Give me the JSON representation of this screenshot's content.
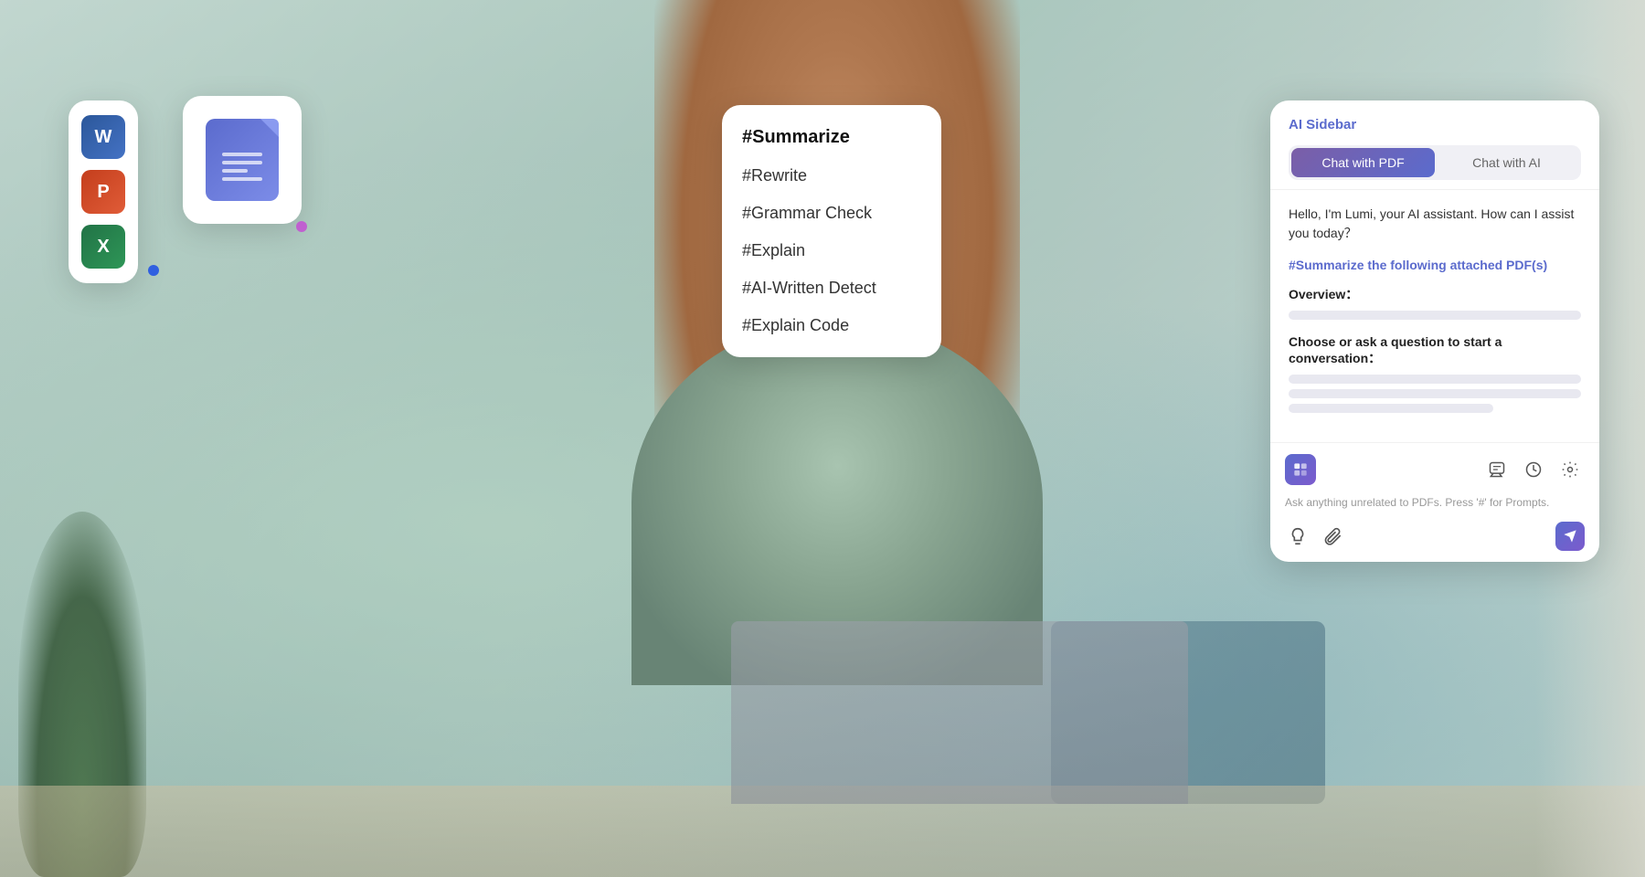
{
  "background": {
    "description": "Woman in green jacket working on laptop"
  },
  "file_icons_panel": {
    "icons": [
      {
        "id": "word",
        "label": "W",
        "type": "word"
      },
      {
        "id": "powerpoint",
        "label": "P",
        "type": "ppt"
      },
      {
        "id": "excel",
        "label": "X",
        "type": "excel"
      }
    ]
  },
  "commands_panel": {
    "items": [
      {
        "id": "summarize",
        "label": "#Summarize",
        "selected": true
      },
      {
        "id": "rewrite",
        "label": "#Rewrite",
        "selected": false
      },
      {
        "id": "grammar",
        "label": "#Grammar Check",
        "selected": false
      },
      {
        "id": "explain",
        "label": "#Explain",
        "selected": false
      },
      {
        "id": "ai-detect",
        "label": "#AI-Written Detect",
        "selected": false
      },
      {
        "id": "explain-code",
        "label": "#Explain Code",
        "selected": false
      }
    ]
  },
  "ai_sidebar": {
    "title": "AI Sidebar",
    "tabs": [
      {
        "id": "chat-pdf",
        "label": "Chat with PDF",
        "active": true
      },
      {
        "id": "chat-ai",
        "label": "Chat with AI",
        "active": false
      }
    ],
    "greeting": "Hello, I'm Lumi, your AI assistant. How can I assist you today？",
    "summarize_prompt": "#Summarize the following attached PDF(s)",
    "overview_label": "Overview：",
    "conversation_label": "Choose or ask a question to start a conversation：",
    "input_hint": "Ask anything unrelated to PDFs. Press '#' for Prompts.",
    "footer_icons": [
      {
        "id": "lumi",
        "type": "lumi-logo"
      },
      {
        "id": "chat-bubble",
        "type": "chat"
      },
      {
        "id": "clock",
        "type": "history"
      },
      {
        "id": "settings",
        "type": "settings"
      }
    ],
    "action_icons": [
      {
        "id": "lightbulb",
        "type": "suggestion"
      },
      {
        "id": "paperclip",
        "type": "attach"
      }
    ],
    "send_button_label": "send"
  }
}
